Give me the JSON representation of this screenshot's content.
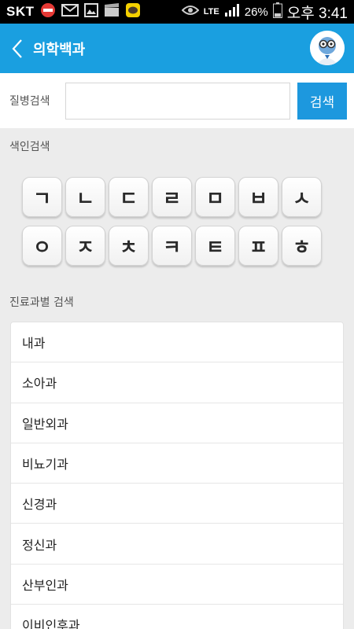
{
  "status_bar": {
    "carrier": "SKT",
    "lte": "LTE",
    "battery": "26%",
    "time": "오후 3:41"
  },
  "app_bar": {
    "title": "의학백과"
  },
  "search": {
    "label": "질병검색",
    "value": "",
    "button": "검색"
  },
  "index": {
    "label": "색인검색",
    "keys": [
      "ㄱ",
      "ㄴ",
      "ㄷ",
      "ㄹ",
      "ㅁ",
      "ㅂ",
      "ㅅ",
      "ㅇ",
      "ㅈ",
      "ㅊ",
      "ㅋ",
      "ㅌ",
      "ㅍ",
      "ㅎ"
    ]
  },
  "departments": {
    "label": "진료과별 검색",
    "items": [
      "내과",
      "소아과",
      "일반외과",
      "비뇨기과",
      "신경과",
      "정신과",
      "산부인과",
      "이비인후과"
    ]
  },
  "colors": {
    "accent": "#1a9fe0",
    "button": "#1d98de",
    "background": "#ececec"
  }
}
